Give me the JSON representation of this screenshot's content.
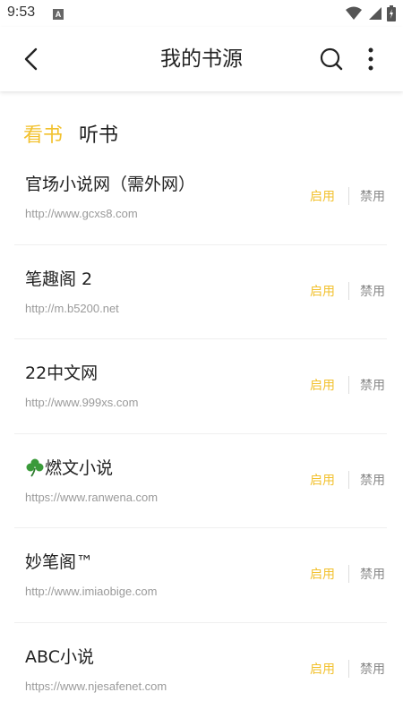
{
  "status": {
    "time": "9:53",
    "notif_letter": "A"
  },
  "header": {
    "title": "我的书源"
  },
  "tabs": [
    {
      "label": "看书",
      "active": true
    },
    {
      "label": "听书",
      "active": false
    }
  ],
  "sources": [
    {
      "name": "官场小说网（需外网）",
      "url": "http://www.gcxs8.com",
      "enable_label": "启用",
      "disable_label": "禁用"
    },
    {
      "name": "笔趣阁 2",
      "url": "http://m.b5200.net",
      "enable_label": "启用",
      "disable_label": "禁用"
    },
    {
      "name": "22中文网",
      "url": "http://www.999xs.com",
      "enable_label": "启用",
      "disable_label": "禁用"
    },
    {
      "name": "燃文小说",
      "prefix_icon": "clover-icon",
      "url": "https://www.ranwena.com",
      "enable_label": "启用",
      "disable_label": "禁用"
    },
    {
      "name": "妙笔阁™",
      "url": "http://www.imiaobige.com",
      "enable_label": "启用",
      "disable_label": "禁用"
    },
    {
      "name": "ABC小说",
      "url": "https://www.njesafenet.com",
      "enable_label": "启用",
      "disable_label": "禁用"
    }
  ],
  "colors": {
    "accent": "#f2c12e",
    "text": "#222222",
    "muted": "#9a9a9a"
  }
}
